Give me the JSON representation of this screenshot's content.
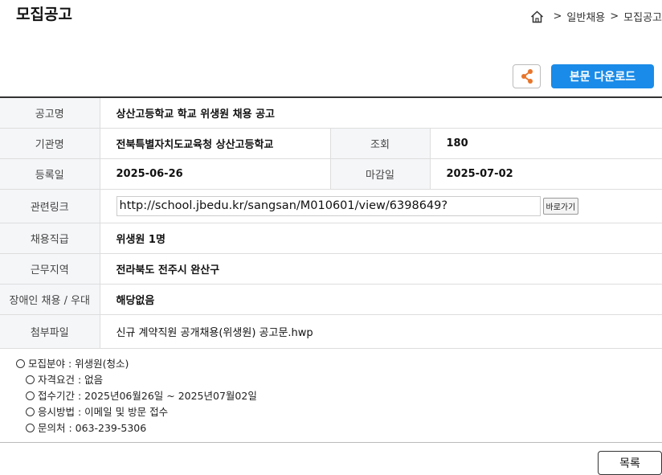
{
  "page": {
    "title": "모집공고"
  },
  "breadcrumb": {
    "items": [
      "일반채용",
      "모집공고"
    ],
    "separator": ">"
  },
  "toolbar": {
    "download_label": "본문 다운로드"
  },
  "colors": {
    "accent": "#1a8be8",
    "share_icon": "#e8752b"
  },
  "info": {
    "title_label": "공고명",
    "title_value": "상산고등학교 학교 위생원 채용 공고",
    "org_label": "기관명",
    "org_value": "전북특별자치도교육청 상산고등학교",
    "views_label": "조회",
    "views_value": "180",
    "reg_label": "등록일",
    "reg_value": "2025-06-26",
    "deadline_label": "마감일",
    "deadline_value": "2025-07-02",
    "link_label": "관련링크",
    "link_value": "http://school.jbedu.kr/sangsan/M010601/view/6398649?",
    "go_label": "바로가기",
    "job_label": "채용직급",
    "job_value": "위생원 1명",
    "area_label": "근무지역",
    "area_value": "전라북도 전주시 완산구",
    "disabled_label": "장애인 채용 / 우대",
    "disabled_value": "해당없음",
    "file_label": "첨부파일",
    "file_value": "신규 계약직원 공개채용(위생원) 공고문.hwp"
  },
  "description": {
    "line1": "모집분야 : 위생원(청소)",
    "line2": "자격요건 : 없음",
    "line3": "접수기간 : 2025년06월26일 ~ 2025년07월02일",
    "line4": "응시방법 : 이메일 및 방문 접수",
    "line5": "문의처 : 063-239-5306"
  },
  "footer": {
    "list_label": "목록"
  }
}
